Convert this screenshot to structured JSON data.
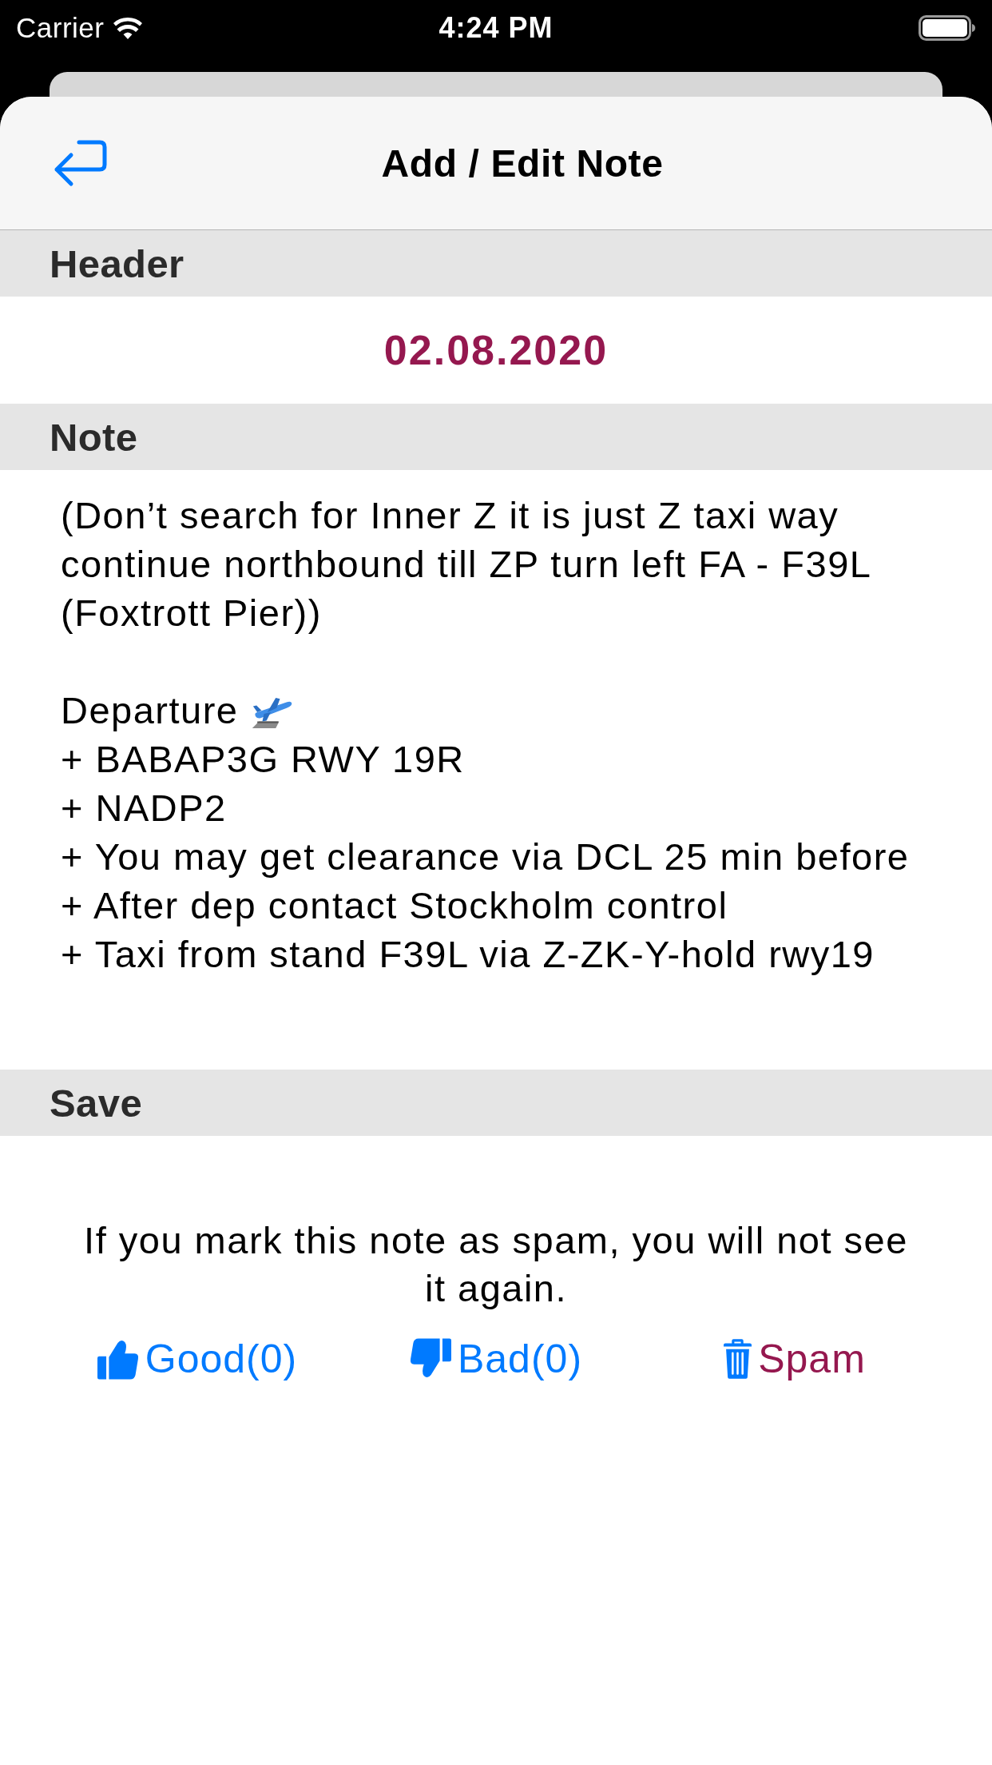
{
  "status_bar": {
    "carrier": "Carrier",
    "time": "4:24 PM"
  },
  "nav_bar": {
    "title": "Add / Edit Note"
  },
  "header_section": {
    "title": "Header",
    "date": "02.08.2020"
  },
  "note_section": {
    "title": "Note",
    "note_field": {
      "intro": "(Don’t search for Inner Z it is just Z taxi way continue northbound till ZP turn left FA - F39L (Foxtrott Pier))",
      "departure_heading": "Departure",
      "items": [
        "+ BABAP3G RWY 19R",
        "+ NADP2",
        "+ You may get clearance via DCL 25 min before",
        "+ After dep contact Stockholm control",
        "+ Taxi from stand F39L via Z-ZK-Y-hold rwy19"
      ]
    }
  },
  "save_section": {
    "title": "Save",
    "spam_notice": "If you mark this note as spam, you will not see it again.",
    "buttons": [
      {
        "kind": "good",
        "label": "Good(0)"
      },
      {
        "kind": "bad",
        "label": "Bad(0)"
      },
      {
        "kind": "spam",
        "label": "Spam"
      }
    ]
  }
}
